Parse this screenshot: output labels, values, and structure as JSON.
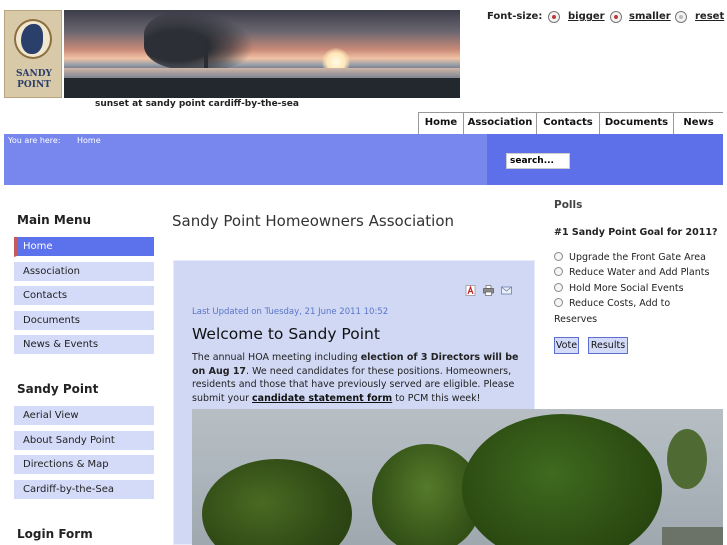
{
  "header": {
    "logo_text_line1": "SANDY",
    "logo_text_line2": "POINT",
    "banner_caption": "sunset at sandy point cardiff-by-the-sea"
  },
  "font_size": {
    "label": "Font-size:",
    "bigger": "bigger",
    "smaller": "smaller",
    "reset": "reset"
  },
  "topnav": {
    "items": [
      "Home",
      "Association",
      "Contacts",
      "Documents",
      "News"
    ]
  },
  "breadcrumb": {
    "label": "You are here:",
    "home": "Home"
  },
  "search": {
    "value": "search..."
  },
  "main_menu": {
    "heading": "Main Menu",
    "items": [
      "Home",
      "Association",
      "Contacts",
      "Documents",
      "News & Events"
    ]
  },
  "sandy_point_menu": {
    "heading": "Sandy Point",
    "items": [
      "Aerial View",
      "About Sandy Point",
      "Directions & Map",
      "Cardiff-by-the-Sea"
    ]
  },
  "login": {
    "heading": "Login Form"
  },
  "main": {
    "page_title": "Sandy Point Homeowners Association",
    "last_updated": "Last Updated on Tuesday, 21 June 2011 10:52",
    "article_title": "Welcome to Sandy Point",
    "body_p1": "The annual HOA meeting including ",
    "body_b1": "election of 3 Directors will be on Aug 17",
    "body_p2": ". We need candidates for these positions. Homeowners, residents and those that have previously served are eligible. Please submit your ",
    "body_link": "candidate statement form",
    "body_p3": " to PCM this week!"
  },
  "polls": {
    "heading": "Polls",
    "question": "#1 Sandy Point Goal for 2011?",
    "options": [
      "Upgrade the Front Gate Area",
      "Reduce Water and Add Plants",
      "Hold More Social Events",
      "Reduce Costs, Add to"
    ],
    "option_continuation": "Reserves",
    "vote_label": "Vote",
    "results_label": "Results"
  },
  "colors": {
    "accent_blue": "#5c72ec",
    "bar_blue": "#7887ee",
    "menu_bg": "#d4dbf8",
    "article_bg": "#d0d8f4",
    "link_blue": "#5a74c9"
  },
  "icons": [
    "pdf-icon",
    "print-icon",
    "email-icon",
    "plus-icon",
    "minus-icon",
    "reset-icon"
  ]
}
